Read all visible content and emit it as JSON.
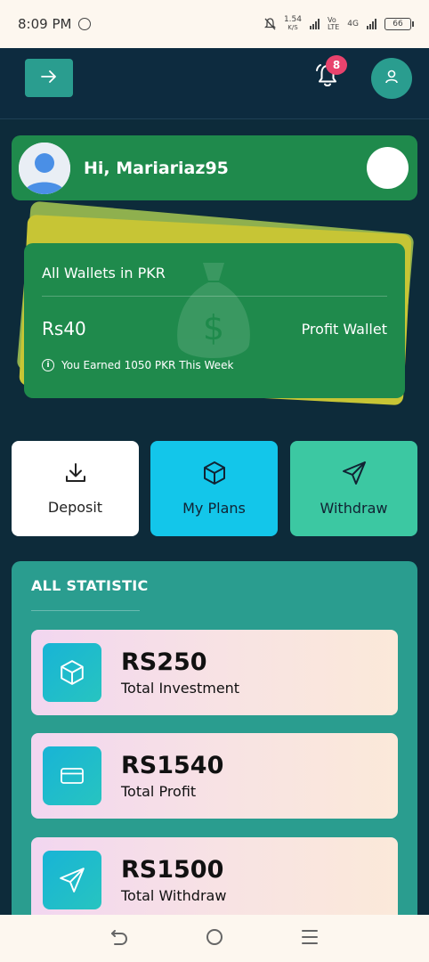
{
  "status_bar": {
    "time": "8:09 PM",
    "net_speed_value": "1.54",
    "net_speed_unit": "K/S",
    "network_type": "4G",
    "battery": "66"
  },
  "header": {
    "notification_count": "8"
  },
  "greeting": {
    "text": "Hi, Mariariaz95"
  },
  "wallet": {
    "title": "All Wallets in PKR",
    "amount": "Rs40",
    "wallet_name": "Profit Wallet",
    "note": "You Earned 1050 PKR This Week"
  },
  "actions": [
    {
      "label": "Deposit",
      "icon": "download-icon"
    },
    {
      "label": "My Plans",
      "icon": "cube-icon"
    },
    {
      "label": "Withdraw",
      "icon": "send-icon"
    }
  ],
  "statistics": {
    "title": "ALL STATISTIC",
    "items": [
      {
        "value": "RS250",
        "label": "Total Investment",
        "icon": "cube-icon"
      },
      {
        "value": "RS1540",
        "label": "Total Profit",
        "icon": "card-icon"
      },
      {
        "value": "RS1500",
        "label": "Total Withdraw",
        "icon": "send-icon"
      }
    ]
  },
  "colors": {
    "background": "#0d2b3a",
    "header": "#0d2b3f",
    "teal": "#2a9d8f",
    "green_card": "#1f8a4c",
    "badge": "#e8436d",
    "plans_button": "#13c6ea",
    "withdraw_button": "#3cc8a2"
  }
}
